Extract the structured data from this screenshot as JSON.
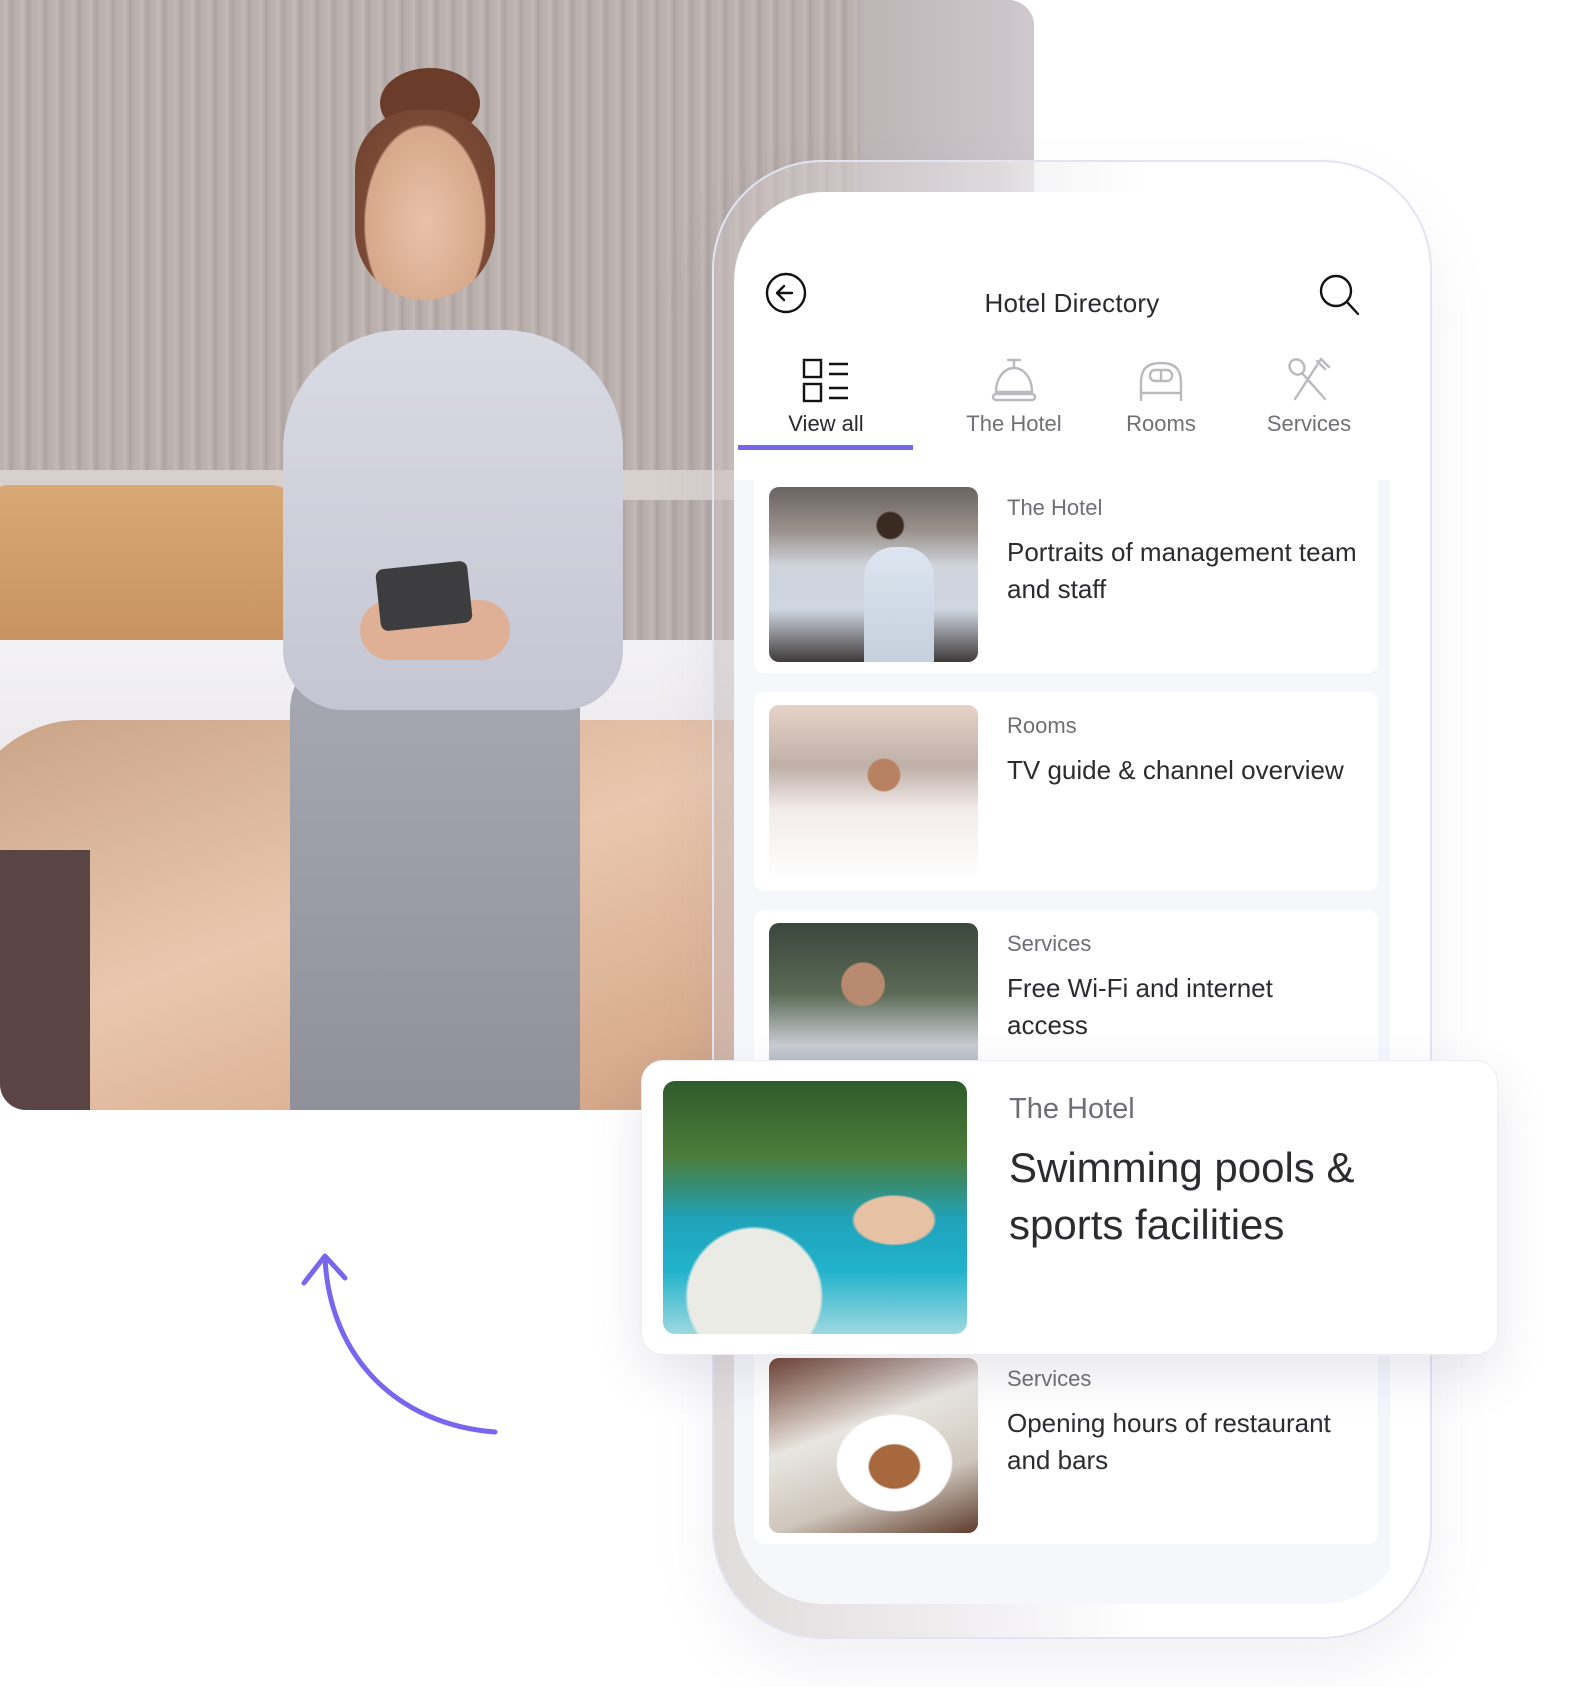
{
  "hero_photo": {
    "description": "Woman in grey shirt sitting on hotel bed using smartphone"
  },
  "app": {
    "header": {
      "title": "Hotel Directory",
      "back_icon": "arrow-left-circle-icon",
      "search_icon": "search-icon"
    },
    "tabs": [
      {
        "label": "View all",
        "icon": "grid-list-icon",
        "active": true
      },
      {
        "label": "The Hotel",
        "icon": "service-bell-icon",
        "active": false
      },
      {
        "label": "Rooms",
        "icon": "bed-icon",
        "active": false
      },
      {
        "label": "Services",
        "icon": "utensils-icon",
        "active": false
      }
    ],
    "accent_color": "#7766ee",
    "cards": [
      {
        "category": "The Hotel",
        "title": "Portraits of management team and staff",
        "image": "staff-photo"
      },
      {
        "category": "Rooms",
        "title": "TV guide & channel overview",
        "image": "couple-tv-photo"
      },
      {
        "category": "Services",
        "title": "Free Wi-Fi and internet access",
        "image": "man-laptop-photo"
      },
      {
        "category": "Services",
        "title": "Opening hours of restaurant and bars",
        "image": "restaurant-dish-photo"
      }
    ],
    "highlighted_card": {
      "category": "The Hotel",
      "title": "Swimming pools & sports facilities",
      "image": "pool-photo"
    }
  },
  "decor": {
    "arrow_color": "#7766ee"
  }
}
